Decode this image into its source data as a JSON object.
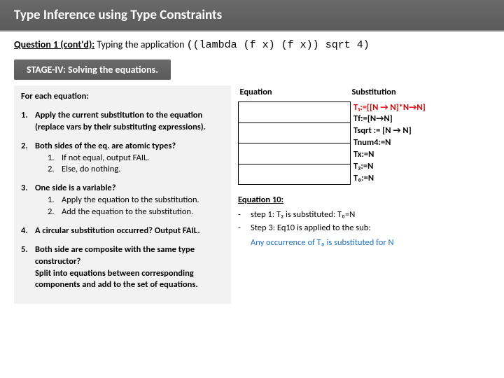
{
  "title": "Type Inference using Type Constraints",
  "question": {
    "label": "Question 1 (cont'd):",
    "text": "Typing the application",
    "code": "((lambda (f x) (f x)) sqrt 4)"
  },
  "stage": "STAGE-IV: Solving the equations.",
  "left": {
    "foreach": "For each equation:",
    "steps": [
      {
        "num": "1.",
        "body": "Apply the current substitution to the equation (replace vars by their substituting expressions)."
      },
      {
        "num": "2.",
        "body": "Both sides of the eq. are atomic types?",
        "subs": [
          {
            "sn": "1.",
            "t": "If not equal, output FAIL."
          },
          {
            "sn": "2.",
            "t": "Else, do nothing."
          }
        ]
      },
      {
        "num": "3.",
        "body": "One side is a variable?",
        "subs": [
          {
            "sn": "1.",
            "t": "Apply the equation to the substitution."
          },
          {
            "sn": "2.",
            "t": "Add the equation to the substitution."
          }
        ]
      },
      {
        "num": "4.",
        "body": "A circular substitution occurred? Output FAIL."
      },
      {
        "num": "5.",
        "body": "Both side are composite with the same type constructor?\nSplit into equations between corresponding components and add to the set of equations."
      }
    ]
  },
  "table": {
    "hdr_eq": "Equation",
    "hdr_sub": "Substitution",
    "subs": [
      "T₁:=[[N → N]*N→N]",
      "Tf:=[N→N]",
      "Tsqrt := [N → N]",
      "Tnum4:=N",
      "Tx:=N",
      "T₂:=N",
      "T₀:=N"
    ],
    "rows": 4
  },
  "eqblock": {
    "title": "Equation 10:",
    "lines": [
      "step 1: T₂  is substituted: T₀=N",
      "Step 3: Eq10 is applied to the sub:"
    ],
    "any": "Any occurrence of T₀ is substituted for N"
  }
}
